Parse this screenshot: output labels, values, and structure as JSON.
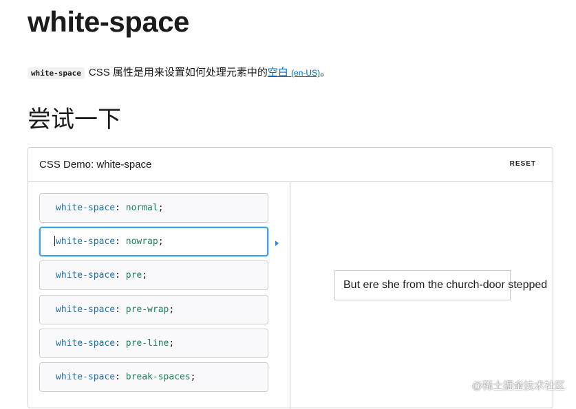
{
  "page": {
    "title": "white-space",
    "intro_code": "white-space",
    "intro_text": "CSS 属性是用来设置如何处理元素中的",
    "intro_link_text": "空白",
    "intro_link_lang": "(en-US)",
    "intro_end": "。",
    "section_title": "尝试一下"
  },
  "demo": {
    "title": "CSS Demo: white-space",
    "reset_label": "RESET",
    "selected_index": 1,
    "options": [
      {
        "property": "white-space",
        "colon": ":",
        "value": "normal",
        "semicolon": ";"
      },
      {
        "property": "white-space",
        "colon": ":",
        "value": "nowrap",
        "semicolon": ";"
      },
      {
        "property": "white-space",
        "colon": ":",
        "value": "pre",
        "semicolon": ";"
      },
      {
        "property": "white-space",
        "colon": ":",
        "value": "pre-wrap",
        "semicolon": ";"
      },
      {
        "property": "white-space",
        "colon": ":",
        "value": "pre-line",
        "semicolon": ";"
      },
      {
        "property": "white-space",
        "colon": ":",
        "value": "break-spaces",
        "semicolon": ";"
      }
    ],
    "output_text": "But ere she from the church-door stepped"
  },
  "watermark": "@稀土掘金技术社区"
}
